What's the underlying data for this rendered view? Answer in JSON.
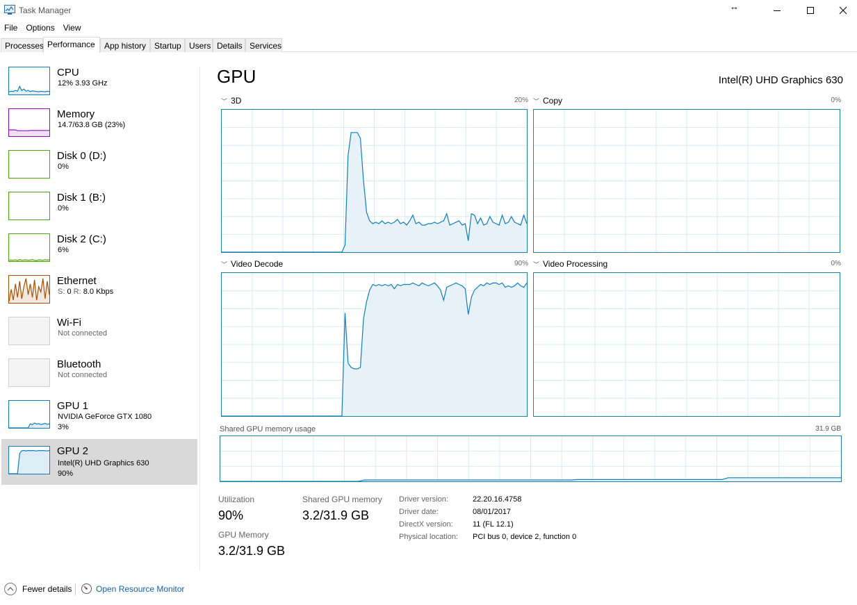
{
  "window": {
    "title": "Task Manager",
    "minimize_glyph": "—",
    "maximize_glyph": "☐",
    "close_glyph": "✕",
    "resize_glyph": "↔"
  },
  "menu": [
    "File",
    "Options",
    "View"
  ],
  "tabs": [
    {
      "label": "Processes",
      "active": false
    },
    {
      "label": "Performance",
      "active": true
    },
    {
      "label": "App history",
      "active": false
    },
    {
      "label": "Startup",
      "active": false
    },
    {
      "label": "Users",
      "active": false
    },
    {
      "label": "Details",
      "active": false
    },
    {
      "label": "Services",
      "active": false
    }
  ],
  "sidebar": {
    "items": [
      {
        "title": "CPU",
        "line1": "12%  3.93 GHz",
        "line2": "",
        "color": "#117dbb"
      },
      {
        "title": "Memory",
        "line1": "14.7/63.8 GB (23%)",
        "line2": "",
        "color": "#8b12ae"
      },
      {
        "title": "Disk 0 (D:)",
        "line1": "0%",
        "line2": "",
        "color": "#4da60c"
      },
      {
        "title": "Disk 1 (B:)",
        "line1": "0%",
        "line2": "",
        "color": "#4da60c"
      },
      {
        "title": "Disk 2 (C:)",
        "line1": "6%",
        "line2": "",
        "color": "#4da60c"
      },
      {
        "title": "Ethernet",
        "line1_prefix_s": "S:",
        "line1_s": "0",
        "line1_prefix_r": "R:",
        "line1_r": "8.0 Kbps",
        "color": "#a74f01"
      },
      {
        "title": "Wi-Fi",
        "line1": "Not connected",
        "line2": "",
        "color": "#cfcfcf"
      },
      {
        "title": "Bluetooth",
        "line1": "Not connected",
        "line2": "",
        "color": "#cfcfcf"
      },
      {
        "title": "GPU 1",
        "line1": "NVIDIA GeForce GTX 1080",
        "line2": "3%",
        "color": "#117dbb"
      },
      {
        "title": "GPU 2",
        "line1": "Intel(R) UHD Graphics 630",
        "line2": "90%",
        "color": "#117dbb"
      }
    ]
  },
  "main": {
    "title": "GPU",
    "device_name": "Intel(R) UHD Graphics 630",
    "engines": [
      {
        "label": "3D",
        "percent": "20%"
      },
      {
        "label": "Copy",
        "percent": "0%"
      },
      {
        "label": "Video Decode",
        "percent": "90%"
      },
      {
        "label": "Video Processing",
        "percent": "0%"
      }
    ],
    "shared_memory": {
      "label": "Shared GPU memory usage",
      "max": "31.9 GB"
    },
    "stats": {
      "utilization_label": "Utilization",
      "utilization_value": "90%",
      "shared_label": "Shared GPU memory",
      "shared_value": "3.2/31.9 GB",
      "gpu_memory_label": "GPU Memory",
      "gpu_memory_value": "3.2/31.9 GB"
    },
    "info": [
      {
        "label": "Driver version:",
        "value": "22.20.16.4758"
      },
      {
        "label": "Driver date:",
        "value": "08/01/2017"
      },
      {
        "label": "DirectX version:",
        "value": "11 (FL 12.1)"
      },
      {
        "label": "Physical location:",
        "value": "PCI bus 0, device 2, function 0"
      }
    ]
  },
  "graphs": {
    "line_color": "#117dbb",
    "fill_color": "#e7f1f8",
    "grid_color": "#d9eaf4",
    "engine_3d": [
      0,
      0,
      0,
      0,
      0,
      0,
      0,
      0,
      0,
      0,
      0,
      0,
      0,
      0,
      0,
      0,
      0,
      0,
      0,
      0,
      0,
      0,
      0,
      0,
      0,
      0,
      0,
      0,
      0,
      0,
      0,
      0,
      0,
      0,
      0,
      0,
      0,
      0,
      0,
      0,
      5,
      68,
      84,
      84,
      84,
      80,
      50,
      28,
      22,
      20,
      21,
      20,
      22,
      20,
      21,
      20,
      21,
      23,
      20,
      21,
      19,
      22,
      26,
      20,
      21,
      19,
      19,
      20,
      20,
      21,
      20,
      21,
      22,
      27,
      19,
      20,
      21,
      22,
      19,
      20,
      8,
      27,
      26,
      20,
      24,
      19,
      20,
      25,
      21,
      20,
      19,
      26,
      20,
      21,
      25,
      21,
      20,
      19,
      26,
      20
    ],
    "engine_copy": [],
    "engine_video_decode": [
      0,
      0,
      0,
      0,
      0,
      0,
      0,
      0,
      0,
      0,
      0,
      0,
      0,
      0,
      0,
      0,
      0,
      0,
      0,
      0,
      0,
      0,
      0,
      0,
      0,
      0,
      0,
      0,
      0,
      0,
      0,
      0,
      0,
      0,
      0,
      0,
      0,
      0,
      0,
      0,
      72,
      37,
      34,
      33,
      33,
      34,
      68,
      80,
      88,
      92,
      91,
      92,
      91,
      92,
      91,
      92,
      89,
      92,
      91,
      92,
      92,
      92,
      93,
      92,
      91,
      93,
      92,
      91,
      92,
      93,
      91,
      88,
      81,
      90,
      91,
      92,
      93,
      92,
      91,
      89,
      71,
      83,
      88,
      90,
      92,
      91,
      93,
      92,
      93,
      93,
      92,
      93,
      90,
      91,
      90,
      91,
      93,
      91,
      90,
      93
    ],
    "engine_video_processing": [],
    "shared_memory_series": [
      0,
      0,
      0,
      0,
      0,
      0,
      0,
      0,
      0,
      0,
      0,
      0,
      0,
      0,
      0,
      0,
      0,
      0,
      0,
      0,
      0,
      0,
      0,
      3,
      3,
      3,
      3,
      3,
      3,
      3,
      3,
      3,
      3,
      3,
      3,
      3,
      3,
      3,
      3,
      3,
      3,
      3,
      3,
      3,
      3,
      3,
      3,
      3,
      3,
      3,
      3,
      3,
      3,
      3,
      3,
      3,
      3,
      4,
      4,
      4,
      4,
      4,
      4,
      4,
      4,
      4,
      4,
      4,
      4,
      4,
      4,
      4,
      4,
      4,
      4,
      4,
      4,
      4,
      4,
      4,
      4,
      8,
      8,
      8,
      8,
      8,
      8,
      8,
      8,
      8,
      8,
      8,
      8,
      8,
      8,
      8,
      8,
      8,
      8,
      8
    ],
    "thumb_cpu": [
      10,
      12,
      11,
      15,
      12,
      30,
      14,
      20,
      12,
      15,
      11,
      13,
      12,
      11,
      10,
      12,
      11,
      10,
      12,
      11
    ],
    "thumb_memory": [
      23,
      23,
      23,
      23,
      20,
      20,
      20,
      20,
      20,
      20,
      21,
      21,
      21,
      21,
      21,
      21,
      21,
      21,
      21,
      21
    ],
    "thumb_disk2": [
      3,
      4,
      3,
      5,
      2,
      6,
      3,
      4,
      5,
      3,
      4,
      6,
      3,
      2,
      5,
      4,
      3,
      6,
      4,
      5
    ],
    "thumb_ethernet": [
      5,
      50,
      10,
      70,
      20,
      80,
      15,
      60,
      90,
      30,
      70,
      20,
      85,
      10,
      60,
      40,
      90,
      15,
      80,
      30
    ],
    "thumb_gpu1": [
      0,
      0,
      0,
      0,
      0,
      0,
      0,
      0,
      0,
      0,
      15,
      12,
      18,
      14,
      16,
      12,
      14,
      17,
      13,
      15
    ],
    "thumb_gpu2": [
      0,
      0,
      0,
      0,
      0,
      75,
      85,
      86,
      84,
      86,
      85,
      86,
      85,
      84,
      86,
      85,
      86,
      85,
      84,
      86
    ]
  },
  "footer": {
    "fewer_details": "Fewer details",
    "resource_monitor": "Open Resource Monitor"
  }
}
